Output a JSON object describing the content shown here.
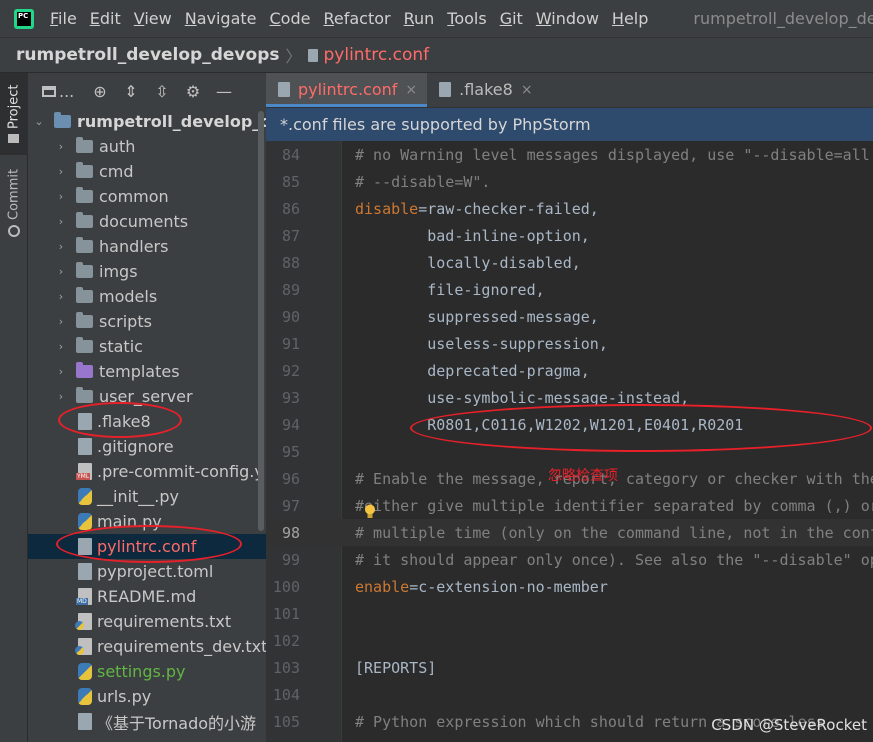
{
  "menubar": {
    "logo_text": "PC",
    "items": [
      "File",
      "Edit",
      "View",
      "Navigate",
      "Code",
      "Refactor",
      "Run",
      "Tools",
      "Git",
      "Window",
      "Help"
    ],
    "window_title": "rumpetroll_develop_de"
  },
  "breadcrumb": {
    "project": "rumpetroll_develop_devops",
    "file": "pylintrc.conf"
  },
  "toolstrip": {
    "project_label": "Project",
    "commit_label": "Commit"
  },
  "project_panel": {
    "toolbar_label": "...",
    "tree": [
      {
        "label": "rumpetroll_develop_de",
        "kind": "root-folder",
        "expand": "open"
      },
      {
        "label": "auth",
        "kind": "folder",
        "expand": "closed"
      },
      {
        "label": "cmd",
        "kind": "folder",
        "expand": "closed"
      },
      {
        "label": "common",
        "kind": "folder",
        "expand": "closed"
      },
      {
        "label": "documents",
        "kind": "folder",
        "expand": "closed"
      },
      {
        "label": "handlers",
        "kind": "folder",
        "expand": "closed"
      },
      {
        "label": "imgs",
        "kind": "folder",
        "expand": "closed"
      },
      {
        "label": "models",
        "kind": "folder",
        "expand": "closed"
      },
      {
        "label": "scripts",
        "kind": "folder",
        "expand": "closed"
      },
      {
        "label": "static",
        "kind": "folder",
        "expand": "closed"
      },
      {
        "label": "templates",
        "kind": "purple-folder",
        "expand": "closed"
      },
      {
        "label": "user_server",
        "kind": "folder",
        "expand": "closed"
      },
      {
        "label": ".flake8",
        "kind": "file"
      },
      {
        "label": ".gitignore",
        "kind": "file"
      },
      {
        "label": ".pre-commit-config.y",
        "kind": "yml"
      },
      {
        "label": "__init__.py",
        "kind": "py"
      },
      {
        "label": "main.py",
        "kind": "py"
      },
      {
        "label": "pylintrc.conf",
        "kind": "file",
        "selected": true,
        "color": "red"
      },
      {
        "label": "pyproject.toml",
        "kind": "file"
      },
      {
        "label": "README.md",
        "kind": "md"
      },
      {
        "label": "requirements.txt",
        "kind": "txt"
      },
      {
        "label": "requirements_dev.txt",
        "kind": "txt"
      },
      {
        "label": "settings.py",
        "kind": "py",
        "color": "green"
      },
      {
        "label": "urls.py",
        "kind": "py"
      },
      {
        "label": "《基于Tornado的小游",
        "kind": "file"
      }
    ]
  },
  "editor": {
    "tabs": [
      {
        "label": "pylintrc.conf",
        "active": true,
        "close": "×"
      },
      {
        "label": ".flake8",
        "active": false,
        "close": "×"
      }
    ],
    "notice": "*.conf files are supported by PhpStorm",
    "current_line": 98,
    "lines": [
      {
        "n": "84",
        "text": "# no Warning level messages displayed, use \"--disable=all --enable=classes",
        "type": "comment"
      },
      {
        "n": "85",
        "text": "# --disable=W\".",
        "type": "comment"
      },
      {
        "n": "86",
        "key": "disable",
        "eq": "=",
        "val": "raw-checker-failed,",
        "type": "kv"
      },
      {
        "n": "87",
        "text": "        bad-inline-option,",
        "type": "plain"
      },
      {
        "n": "88",
        "text": "        locally-disabled,",
        "type": "plain"
      },
      {
        "n": "89",
        "text": "        file-ignored,",
        "type": "plain"
      },
      {
        "n": "90",
        "text": "        suppressed-message,",
        "type": "plain"
      },
      {
        "n": "91",
        "text": "        useless-suppression,",
        "type": "plain"
      },
      {
        "n": "92",
        "text": "        deprecated-pragma,",
        "type": "plain"
      },
      {
        "n": "93",
        "text": "        use-symbolic-message-instead,",
        "type": "plain"
      },
      {
        "n": "94",
        "text": "        R0801,C0116,W1202,W1201,E0401,R0201",
        "type": "plain"
      },
      {
        "n": "95",
        "text": "",
        "type": "plain"
      },
      {
        "n": "96",
        "text": "# Enable the message, report, category or checker with the given id(s). You can",
        "type": "comment"
      },
      {
        "n": "97",
        "text": "#either give multiple identifier separated by comma (,) or put this option",
        "type": "comment"
      },
      {
        "n": "98",
        "text": "# multiple time (only on the command line, not in the configuration file where",
        "type": "comment"
      },
      {
        "n": "99",
        "text": "# it should appear only once). See also the \"--disable\" option for examples.",
        "type": "comment"
      },
      {
        "n": "100",
        "key": "enable",
        "eq": "=",
        "val": "c-extension-no-member",
        "type": "kv"
      },
      {
        "n": "101",
        "text": "",
        "type": "plain"
      },
      {
        "n": "102",
        "text": "",
        "type": "plain"
      },
      {
        "n": "103",
        "text": "[REPORTS]",
        "type": "plain"
      },
      {
        "n": "104",
        "text": "",
        "type": "plain"
      },
      {
        "n": "105",
        "text": "# Python expression which should return a score less",
        "type": "comment"
      }
    ]
  },
  "annotation": {
    "note": "忽略检查项",
    "color": "#e8202a"
  },
  "watermark": "CSDN @SteveRocket"
}
